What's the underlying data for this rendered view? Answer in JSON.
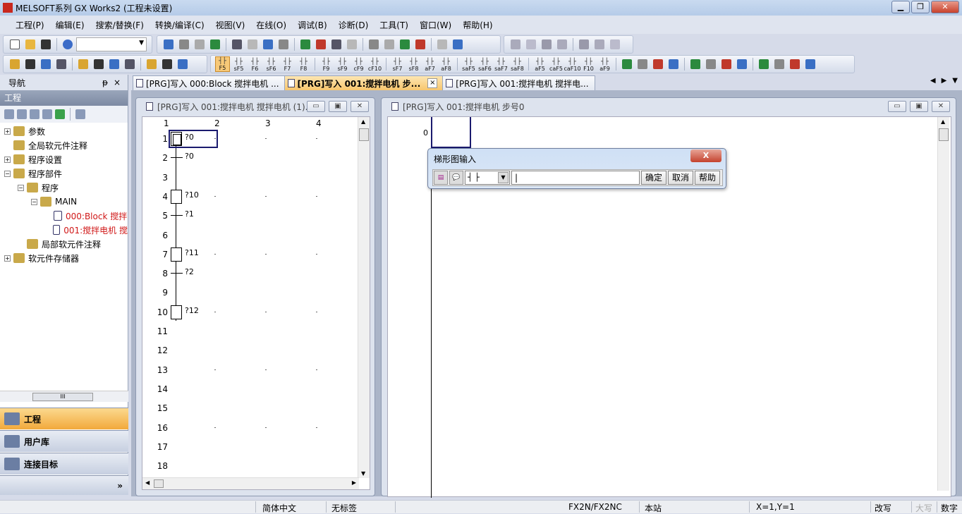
{
  "app": {
    "title": "MELSOFT系列 GX Works2 (工程未设置)",
    "logo": "GX"
  },
  "menu": [
    "工程(P)",
    "编辑(E)",
    "搜索/替换(F)",
    "转换/编译(C)",
    "视图(V)",
    "在线(O)",
    "调试(B)",
    "诊断(D)",
    "工具(T)",
    "窗口(W)",
    "帮助(H)"
  ],
  "toolbar2_keys": [
    "F5",
    "sF5",
    "F6",
    "sF6",
    "F7",
    "F8",
    "F9",
    "sF9",
    "cF9",
    "cF10",
    "sF7",
    "sF8",
    "aF7",
    "aF8",
    "saF5",
    "saF6",
    "saF7",
    "saF8",
    "aF5",
    "caF5",
    "caF10",
    "F10",
    "aF9"
  ],
  "nav": {
    "title": "导航",
    "pin": "ᵽ",
    "close": "×",
    "section": "工程",
    "tree": [
      {
        "label": "参数",
        "exp": "+",
        "indent": 0
      },
      {
        "label": "全局软元件注释",
        "exp": "",
        "indent": 0
      },
      {
        "label": "程序设置",
        "exp": "+",
        "indent": 0
      },
      {
        "label": "程序部件",
        "exp": "−",
        "indent": 0
      },
      {
        "label": "程序",
        "exp": "−",
        "indent": 1
      },
      {
        "label": "MAIN",
        "exp": "−",
        "indent": 2
      },
      {
        "label": "000:Block 搅拌",
        "exp": "",
        "indent": 3,
        "red": true
      },
      {
        "label": "001:搅拌电机 搅",
        "exp": "",
        "indent": 3,
        "red": true
      },
      {
        "label": "局部软元件注释",
        "exp": "",
        "indent": 1
      },
      {
        "label": "软元件存储器",
        "exp": "+",
        "indent": 0
      }
    ],
    "scroll_label": "III",
    "buttons": [
      "工程",
      "用户库",
      "连接目标"
    ],
    "more": "»"
  },
  "tabs": [
    {
      "label": "[PRG]写入 000:Block 搅拌电机 ..."
    },
    {
      "label": "[PRG]写入 001:搅拌电机 步...",
      "active": true,
      "close": "×"
    },
    {
      "label": "[PRG]写入 001:搅拌电机 搅拌电..."
    }
  ],
  "tabnav": [
    "◀",
    "▶",
    "▼"
  ],
  "sfc_window": {
    "title": "[PRG]写入 001:搅拌电机 搅拌电机 (1)...",
    "columns": [
      "1",
      "2",
      "3",
      "4"
    ],
    "rows": [
      {
        "n": "1",
        "type": "init",
        "label": "?0"
      },
      {
        "n": "2",
        "type": "trans",
        "label": "?0"
      },
      {
        "n": "3",
        "type": "line"
      },
      {
        "n": "4",
        "type": "step",
        "label": "?10"
      },
      {
        "n": "5",
        "type": "trans",
        "label": "?1"
      },
      {
        "n": "6",
        "type": "line"
      },
      {
        "n": "7",
        "type": "step",
        "label": "?11"
      },
      {
        "n": "8",
        "type": "trans",
        "label": "?2"
      },
      {
        "n": "9",
        "type": "line"
      },
      {
        "n": "10",
        "type": "step",
        "label": "?12"
      },
      {
        "n": "11"
      },
      {
        "n": "12"
      },
      {
        "n": "13"
      },
      {
        "n": "14"
      },
      {
        "n": "15"
      },
      {
        "n": "16"
      },
      {
        "n": "17"
      },
      {
        "n": "18"
      }
    ]
  },
  "ladder_window": {
    "title": "[PRG]写入 001:搅拌电机 步号0",
    "step": "0"
  },
  "dialog": {
    "title": "梯形图输入",
    "close": "X",
    "symbol": "┤ ├",
    "input": "|",
    "ok": "确定",
    "cancel": "取消",
    "help": "帮助"
  },
  "status": {
    "lang": "简体中文",
    "label": "无标签",
    "plc": "FX2N/FX2NC",
    "station": "本站",
    "pos": "X=1,Y=1",
    "mode": "改写",
    "caps": "大写",
    "num": "数字"
  }
}
